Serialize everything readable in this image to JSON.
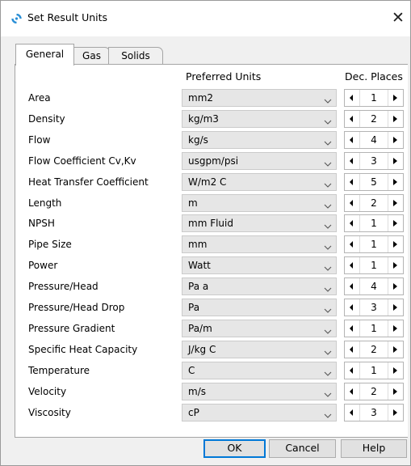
{
  "window": {
    "title": "Set Result Units",
    "close_glyph": "✕"
  },
  "tabs": [
    {
      "label": "General",
      "active": true
    },
    {
      "label": "Gas",
      "active": false
    },
    {
      "label": "Solids",
      "active": false
    }
  ],
  "headers": {
    "units": "Preferred Units",
    "decimals": "Dec. Places"
  },
  "rows": [
    {
      "label": "Area",
      "unit": "mm2",
      "decimals": "1"
    },
    {
      "label": "Density",
      "unit": "kg/m3",
      "decimals": "2"
    },
    {
      "label": "Flow",
      "unit": "kg/s",
      "decimals": "4"
    },
    {
      "label": "Flow Coefficient Cv,Kv",
      "unit": "usgpm/psi",
      "decimals": "3"
    },
    {
      "label": "Heat Transfer Coefficient",
      "unit": "W/m2 C",
      "decimals": "5"
    },
    {
      "label": "Length",
      "unit": "m",
      "decimals": "2"
    },
    {
      "label": "NPSH",
      "unit": "mm Fluid",
      "decimals": "1"
    },
    {
      "label": "Pipe Size",
      "unit": "mm",
      "decimals": "1"
    },
    {
      "label": "Power",
      "unit": "Watt",
      "decimals": "1"
    },
    {
      "label": "Pressure/Head",
      "unit": "Pa a",
      "decimals": "4"
    },
    {
      "label": "Pressure/Head Drop",
      "unit": "Pa",
      "decimals": "3"
    },
    {
      "label": "Pressure Gradient",
      "unit": "Pa/m",
      "decimals": "1"
    },
    {
      "label": "Specific Heat Capacity",
      "unit": "J/kg C",
      "decimals": "2"
    },
    {
      "label": "Temperature",
      "unit": "C",
      "decimals": "1"
    },
    {
      "label": "Velocity",
      "unit": "m/s",
      "decimals": "2"
    },
    {
      "label": "Viscosity",
      "unit": "cP",
      "decimals": "3"
    }
  ],
  "buttons": {
    "ok": "OK",
    "cancel": "Cancel",
    "help": "Help"
  },
  "colors": {
    "app_icon": "#2a8fd6",
    "focus_border": "#0078d7"
  }
}
